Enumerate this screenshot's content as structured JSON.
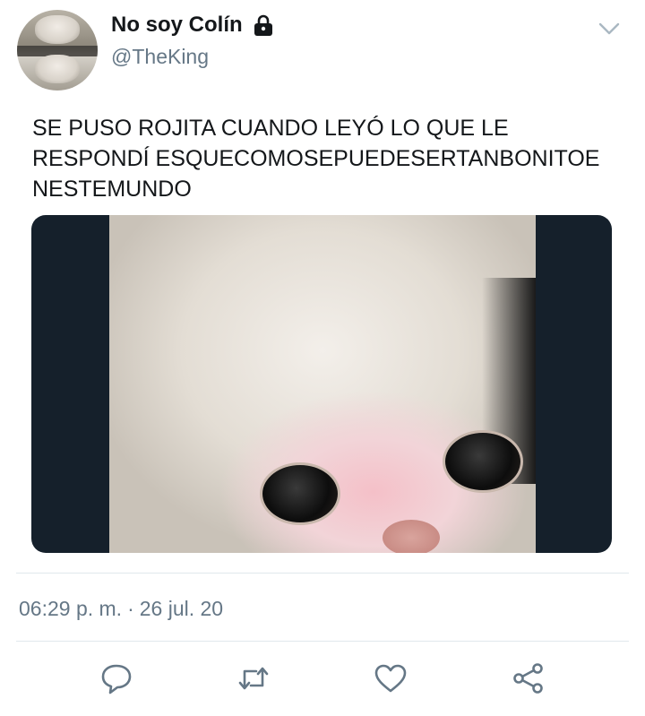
{
  "tweet": {
    "author": {
      "display_name": "No soy Colín",
      "handle": "@TheKing",
      "avatar_icon": "cat-avatar"
    },
    "text": "SE PUSO ROJITA CUANDO LEYÓ LO QUE LE\nRESPONDÍ ESQUECOMOSEPUEDESERTANBONITOE\nNESTEMUNDO",
    "media": {
      "icon": "crying-white-cat-photo"
    },
    "time": "06:29 p. m.",
    "separator": "·",
    "date": "26 jul. 20"
  },
  "icons": {
    "lock": "lock-icon",
    "menu": "chevron-down-icon",
    "reply": "reply-icon",
    "retweet": "retweet-icon",
    "like": "heart-icon",
    "share": "share-icon"
  },
  "colors": {
    "text": "#14171a",
    "secondary": "#657786",
    "icon": "#657786",
    "media_background": "#15202b",
    "divider": "#e1e8ed"
  }
}
